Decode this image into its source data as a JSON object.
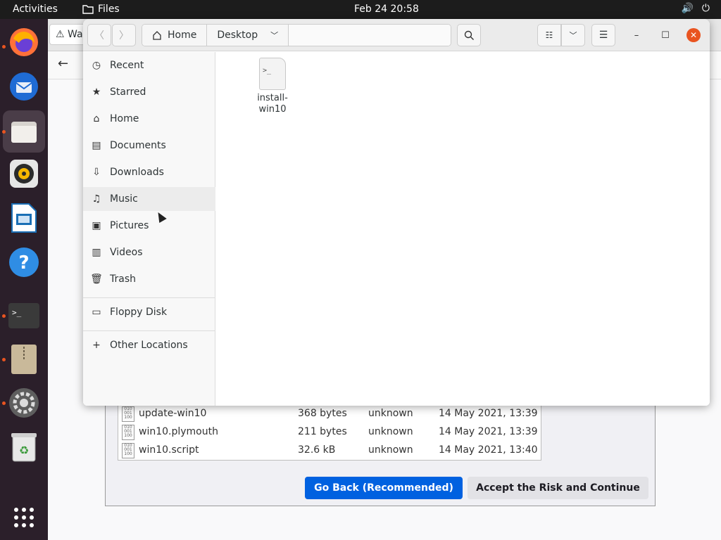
{
  "topbar": {
    "activities": "Activities",
    "app_name": "Files",
    "clock": "Feb 24  20:58"
  },
  "dock": {
    "items": [
      "firefox-icon",
      "thunderbird-icon",
      "files-icon",
      "rhythmbox-icon",
      "libreoffice-impress-icon",
      "help-icon",
      "terminal-icon",
      "archive-icon",
      "settings-icon",
      "trash-icon",
      "app-grid-icon"
    ]
  },
  "browser": {
    "tab_label": "Wa",
    "files": [
      {
        "name": "update-win10",
        "size": "368 bytes",
        "type": "unknown",
        "date": "14 May 2021, 13:39"
      },
      {
        "name": "win10.plymouth",
        "size": "211 bytes",
        "type": "unknown",
        "date": "14 May 2021, 13:39"
      },
      {
        "name": "win10.script",
        "size": "32.6 kB",
        "type": "unknown",
        "date": "14 May 2021, 13:40"
      }
    ],
    "go_back_label": "Go Back (Recommended)",
    "accept_label": "Accept the Risk and Continue",
    "primary_color": "#0061e0"
  },
  "files_window": {
    "path": [
      "Home",
      "Desktop"
    ],
    "sidebar": [
      {
        "label": "Recent",
        "icon": "clock-icon"
      },
      {
        "label": "Starred",
        "icon": "star-icon"
      },
      {
        "label": "Home",
        "icon": "home-icon"
      },
      {
        "label": "Documents",
        "icon": "document-icon"
      },
      {
        "label": "Downloads",
        "icon": "download-icon"
      },
      {
        "label": "Music",
        "icon": "music-icon"
      },
      {
        "label": "Pictures",
        "icon": "picture-icon"
      },
      {
        "label": "Videos",
        "icon": "video-icon"
      },
      {
        "label": "Trash",
        "icon": "trash-icon"
      },
      {
        "label": "Floppy Disk",
        "icon": "floppy-icon"
      },
      {
        "label": "Other Locations",
        "icon": "plus-icon"
      }
    ],
    "file": {
      "name": "install-win10",
      "icon_glyph": ">_"
    }
  }
}
